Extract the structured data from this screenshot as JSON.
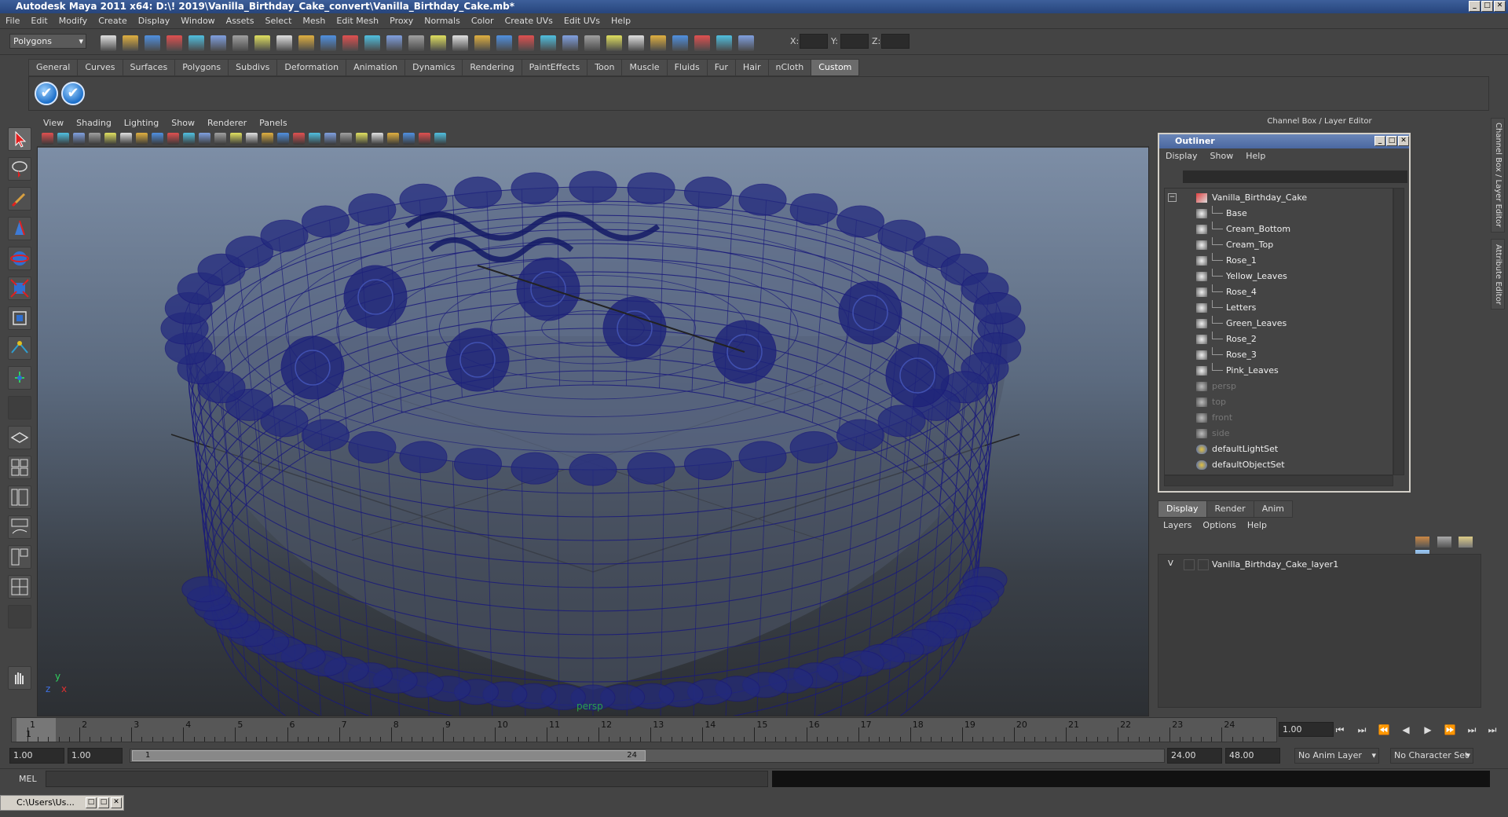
{
  "window": {
    "title": "Autodesk Maya 2011 x64: D:\\! 2019\\Vanilla_Birthday_Cake_convert\\Vanilla_Birthday_Cake.mb*",
    "min": "_",
    "max": "□",
    "close": "✕"
  },
  "menubar": [
    "File",
    "Edit",
    "Modify",
    "Create",
    "Display",
    "Window",
    "Assets",
    "Select",
    "Mesh",
    "Edit Mesh",
    "Proxy",
    "Normals",
    "Color",
    "Create UVs",
    "Edit UVs",
    "Help"
  ],
  "statusline": {
    "mode": "Polygons",
    "x_label": "X:",
    "y_label": "Y:",
    "z_label": "Z:"
  },
  "shelf": {
    "tabs": [
      "General",
      "Curves",
      "Surfaces",
      "Polygons",
      "Subdivs",
      "Deformation",
      "Animation",
      "Dynamics",
      "Rendering",
      "PaintEffects",
      "Toon",
      "Muscle",
      "Fluids",
      "Fur",
      "Hair",
      "nCloth",
      "Custom"
    ],
    "active_tab": "Custom"
  },
  "viewport": {
    "menu": [
      "View",
      "Shading",
      "Lighting",
      "Show",
      "Renderer",
      "Panels"
    ],
    "camera_label": "persp",
    "axis_y": "y",
    "axis_x": "x",
    "axis_z": "z",
    "wire_color": "#1a1a7a"
  },
  "channel_box": {
    "header": "Channel Box / Layer Editor"
  },
  "outliner": {
    "title": "Outliner",
    "menu": [
      "Display",
      "Show",
      "Help"
    ],
    "items": [
      {
        "label": "Vanilla_Birthday_Cake",
        "indent": 0,
        "dim": false,
        "kind": "group"
      },
      {
        "label": "Base",
        "indent": 1,
        "dim": false,
        "kind": "mesh"
      },
      {
        "label": "Cream_Bottom",
        "indent": 1,
        "dim": false,
        "kind": "mesh"
      },
      {
        "label": "Cream_Top",
        "indent": 1,
        "dim": false,
        "kind": "mesh"
      },
      {
        "label": "Rose_1",
        "indent": 1,
        "dim": false,
        "kind": "mesh"
      },
      {
        "label": "Yellow_Leaves",
        "indent": 1,
        "dim": false,
        "kind": "mesh"
      },
      {
        "label": "Rose_4",
        "indent": 1,
        "dim": false,
        "kind": "mesh"
      },
      {
        "label": "Letters",
        "indent": 1,
        "dim": false,
        "kind": "mesh"
      },
      {
        "label": "Green_Leaves",
        "indent": 1,
        "dim": false,
        "kind": "mesh"
      },
      {
        "label": "Rose_2",
        "indent": 1,
        "dim": false,
        "kind": "mesh"
      },
      {
        "label": "Rose_3",
        "indent": 1,
        "dim": false,
        "kind": "mesh"
      },
      {
        "label": "Pink_Leaves",
        "indent": 1,
        "dim": false,
        "kind": "mesh"
      },
      {
        "label": "persp",
        "indent": 0,
        "dim": true,
        "kind": "camera"
      },
      {
        "label": "top",
        "indent": 0,
        "dim": true,
        "kind": "camera"
      },
      {
        "label": "front",
        "indent": 0,
        "dim": true,
        "kind": "camera"
      },
      {
        "label": "side",
        "indent": 0,
        "dim": true,
        "kind": "camera"
      },
      {
        "label": "defaultLightSet",
        "indent": 0,
        "dim": false,
        "kind": "set"
      },
      {
        "label": "defaultObjectSet",
        "indent": 0,
        "dim": false,
        "kind": "set"
      }
    ]
  },
  "layer_editor": {
    "tabs": [
      "Display",
      "Render",
      "Anim"
    ],
    "active_tab": "Display",
    "menu": [
      "Layers",
      "Options",
      "Help"
    ],
    "layer": {
      "visible": "V",
      "name": "Vanilla_Birthday_Cake_layer1"
    }
  },
  "side_tabs": [
    "Channel Box / Layer Editor",
    "Attribute Editor"
  ],
  "timeline": {
    "ticks": [
      "1",
      "2",
      "3",
      "4",
      "5",
      "6",
      "7",
      "8",
      "9",
      "10",
      "11",
      "12",
      "13",
      "14",
      "15",
      "16",
      "17",
      "18",
      "19",
      "20",
      "21",
      "22",
      "23",
      "24"
    ],
    "current_marker": "1",
    "current_frame": "1.00"
  },
  "range": {
    "start": "1.00",
    "playback_start": "1.00",
    "thumb_start": "1",
    "thumb_end": "24",
    "playback_end": "24.00",
    "end": "48.00",
    "anim_layer": "No Anim Layer",
    "char_set": "No Character Set"
  },
  "command": {
    "label": "MEL"
  },
  "taskbar": {
    "label": "C:\\Users\\Us..."
  }
}
